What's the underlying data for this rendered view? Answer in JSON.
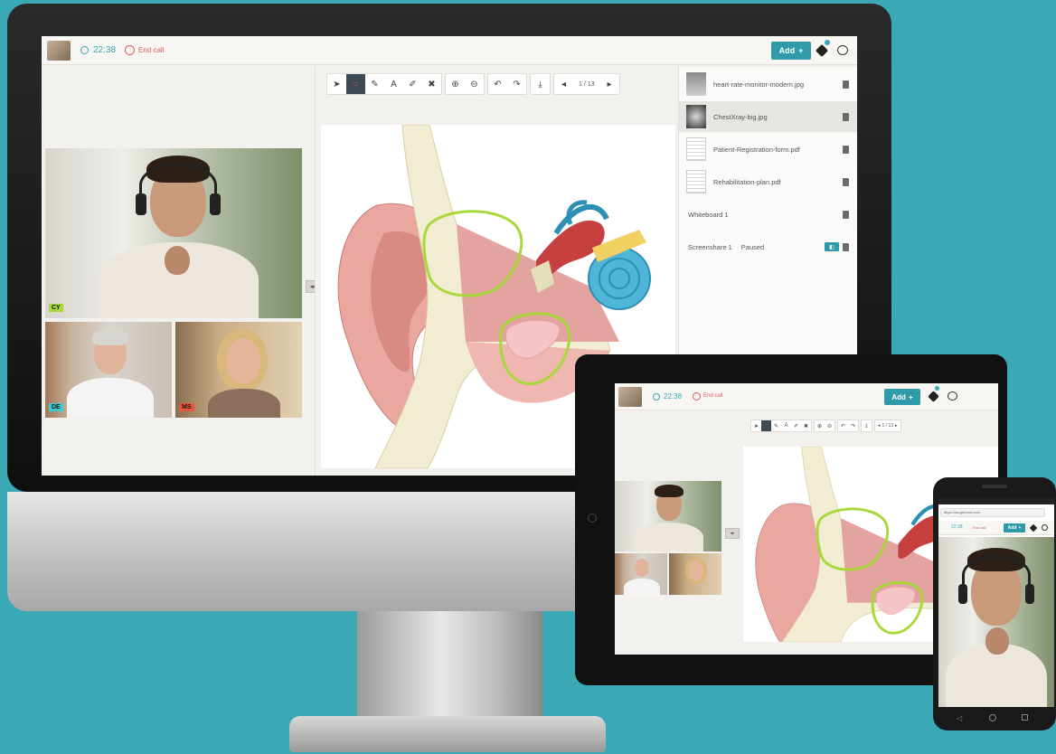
{
  "desktop": {
    "call": {
      "timer": "22:38",
      "end_call_label": "End call",
      "add_label": "Add"
    },
    "toolbar": {
      "page_indicator": "1 / 13"
    },
    "participants": [
      {
        "initials": "CY",
        "tag_color": "#a8d83a"
      },
      {
        "initials": "DE",
        "tag_color": "#3fc9d0"
      },
      {
        "initials": "MS",
        "tag_color": "#e8573a"
      }
    ],
    "files": [
      {
        "name": "heart-rate-monitor-modern.jpg"
      },
      {
        "name": "ChestXray-big.jpg"
      },
      {
        "name": "Patient-Registration-form.pdf"
      },
      {
        "name": "Rehabilitation-plan.pdf"
      },
      {
        "name": "Whiteboard 1"
      },
      {
        "name": "Screenshare 1",
        "status": "Paused"
      }
    ]
  },
  "tablet": {
    "call": {
      "timer": "22:38",
      "end_call_label": "End call",
      "add_label": "Add"
    },
    "toolbar": {
      "page_indicator": "1 / 13"
    }
  },
  "phone": {
    "url": "https://surgeroom.com",
    "call": {
      "timer": "22:38",
      "end_call_label": "End call",
      "add_label": "Add"
    }
  },
  "colors": {
    "background": "#3ba8b5",
    "accent": "#2f9aa8",
    "end_call": "#e05a5a",
    "annotation": "#a8d83a"
  }
}
